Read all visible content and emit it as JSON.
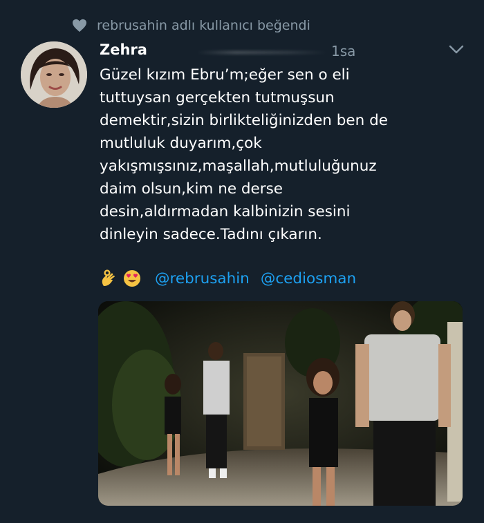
{
  "social_context": {
    "liked_text": "rebrusahin adlı kullanıcı beğendi",
    "icon": "heart-icon"
  },
  "tweet": {
    "author_name": "Zehra",
    "timestamp": "1sa",
    "text_lines": [
      "Güzel kızım Ebru’m;eğer sen o eli",
      "tuttuysan gerçekten tutmuşsun",
      "demektir,sizin birlikteliğinizden ben de",
      "mutluluk duyarım,çok",
      "yakışmışsınız,maşallah,mutluluğunuz",
      "daim olsun,kim ne derse",
      "desin,aldırmadan kalbinizin sesini",
      "dinleyin sadece.Tadını çıkarın."
    ],
    "emojis": [
      "ok-hand-emoji",
      "heart-eyes-emoji"
    ],
    "mentions": [
      "@rebrusahin",
      "@cediosman"
    ],
    "more_icon": "chevron-down-icon"
  },
  "colors": {
    "background": "#15202b",
    "secondary_text": "#8899a6",
    "link": "#1da1f2"
  }
}
